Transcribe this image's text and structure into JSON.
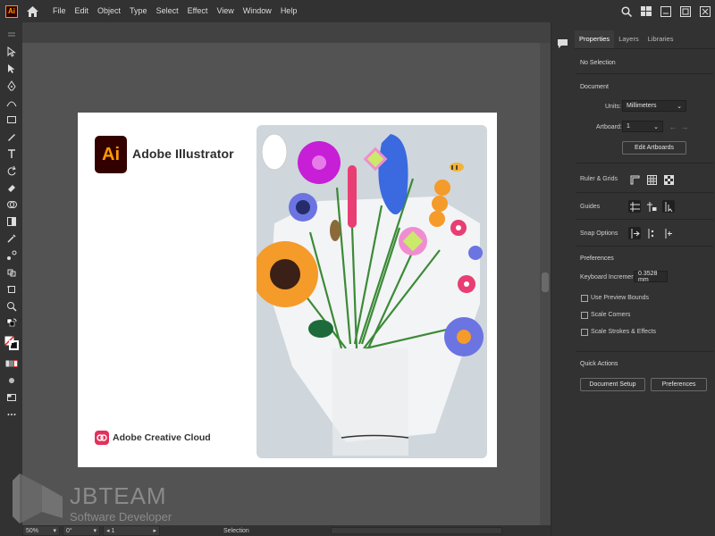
{
  "app": {
    "logo": "Ai"
  },
  "menu": [
    "File",
    "Edit",
    "Object",
    "Type",
    "Select",
    "Effect",
    "View",
    "Window",
    "Help"
  ],
  "splash": {
    "logo": "Ai",
    "app_name": "Adobe Illustrator",
    "cloud_label": "Adobe Creative Cloud"
  },
  "watermark": {
    "title": "JBTEAM",
    "subtitle": "Software Developer"
  },
  "status": {
    "zoom": "50%",
    "rotation": "0°",
    "artboard": "1",
    "tool": "Selection"
  },
  "panel": {
    "tabs": [
      "Properties",
      "Layers",
      "Libraries"
    ],
    "no_selection": "No Selection",
    "document_header": "Document",
    "units_label": "Units:",
    "units_value": "Millimeters",
    "artboard_label": "Artboard:",
    "artboard_value": "1",
    "edit_artboards": "Edit Artboards",
    "ruler_grids": "Ruler & Grids",
    "guides": "Guides",
    "snap_options": "Snap Options",
    "preferences_header": "Preferences",
    "keyboard_increment_label": "Keyboard Increment:",
    "keyboard_increment_value": "0.3528 mm",
    "use_preview_bounds": "Use Preview Bounds",
    "scale_corners": "Scale Corners",
    "scale_strokes": "Scale Strokes & Effects",
    "quick_actions": "Quick Actions",
    "document_setup": "Document Setup",
    "preferences_button": "Preferences"
  },
  "colors": {
    "ai_orange": "#ff9a00",
    "ai_dark": "#330000",
    "chrome_dark": "#323232",
    "canvas": "#535353"
  }
}
